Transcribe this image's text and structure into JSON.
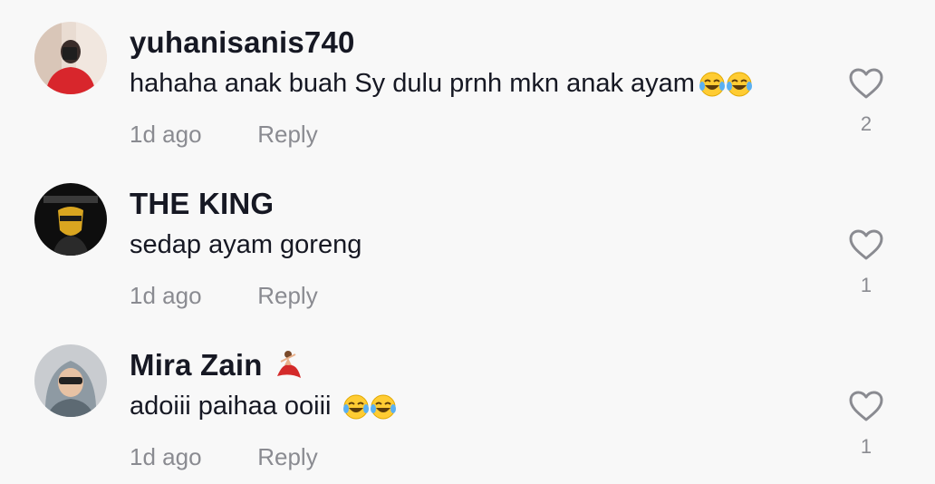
{
  "comments": [
    {
      "username": "yuhanisanis740",
      "text": "hahaha anak buah Sy dulu prnh mkn anak ayam",
      "emojis": [
        "tears-of-joy",
        "tears-of-joy"
      ],
      "time": "1d ago",
      "reply_label": "Reply",
      "likes": "2"
    },
    {
      "username": "THE KING",
      "text": "sedap ayam goreng",
      "emojis": [],
      "time": "1d ago",
      "reply_label": "Reply",
      "likes": "1"
    },
    {
      "username": "Mira Zain",
      "username_emoji": "dancer",
      "text": "adoiii paihaa ooiii ",
      "emojis": [
        "tears-of-joy",
        "tears-of-joy"
      ],
      "time": "1d ago",
      "reply_label": "Reply",
      "likes": "1"
    }
  ],
  "colors": {
    "background": "#f8f8f8",
    "primary_text": "#161823",
    "secondary_text": "#8a8b91"
  }
}
